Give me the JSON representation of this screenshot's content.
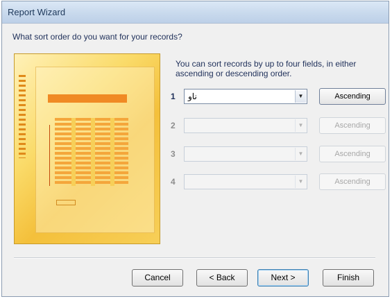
{
  "window": {
    "title": "Report Wizard"
  },
  "question": "What sort order do you want for your records?",
  "description": "You can sort records by up to four fields, in either ascending or descending order.",
  "sort_rows": [
    {
      "number": "1",
      "field_value": "ناو",
      "order_label": "Ascending",
      "enabled": true
    },
    {
      "number": "2",
      "field_value": "",
      "order_label": "Ascending",
      "enabled": false
    },
    {
      "number": "3",
      "field_value": "",
      "order_label": "Ascending",
      "enabled": false
    },
    {
      "number": "4",
      "field_value": "",
      "order_label": "Ascending",
      "enabled": false
    }
  ],
  "buttons": {
    "cancel": "Cancel",
    "back": "< Back",
    "next": "Next >",
    "finish": "Finish"
  },
  "icons": {
    "dropdown": "chevron-down-icon"
  },
  "colors": {
    "titlebar": "#c7d8ec",
    "text": "#1e2f59",
    "illustration_accent": "#f08a24"
  }
}
